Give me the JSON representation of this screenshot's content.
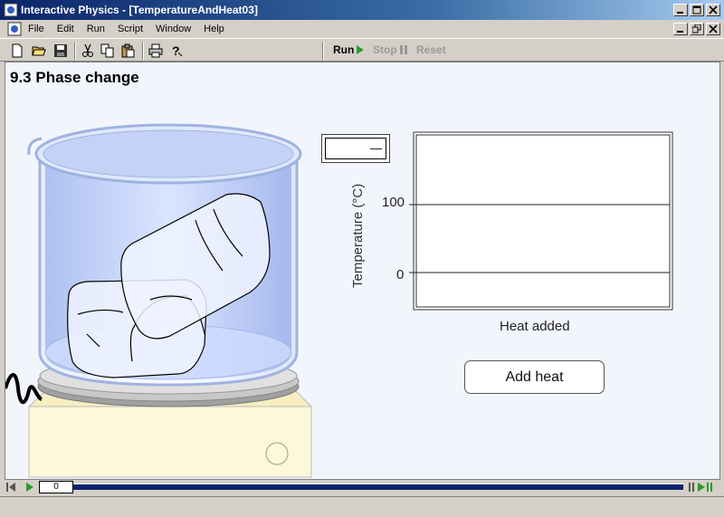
{
  "window": {
    "title": "Interactive Physics - [TemperatureAndHeat03]"
  },
  "menu": {
    "items": [
      "File",
      "Edit",
      "Run",
      "Script",
      "Window",
      "Help"
    ]
  },
  "toolbar": {
    "icons": [
      "new-file-icon",
      "open-folder-icon",
      "save-icon",
      "cut-icon",
      "copy-icon",
      "paste-icon",
      "print-icon",
      "help-icon"
    ],
    "run_label": "Run",
    "stop_label": "Stop",
    "reset_label": "Reset"
  },
  "simulation": {
    "heading": "9.3 Phase change"
  },
  "graph": {
    "readout_value": "—",
    "y_axis_label": "Temperature (°C)",
    "x_axis_label": "Heat added",
    "y_ticks": [
      "100",
      "0"
    ]
  },
  "controls": {
    "add_heat_label": "Add heat"
  },
  "playback": {
    "frame_counter": "0"
  },
  "colors": {
    "title_bar": "#0a246a",
    "run_green": "#2a9a2a",
    "water_blue": "#c8d8ff",
    "hotplate": "#fdf8d8"
  }
}
